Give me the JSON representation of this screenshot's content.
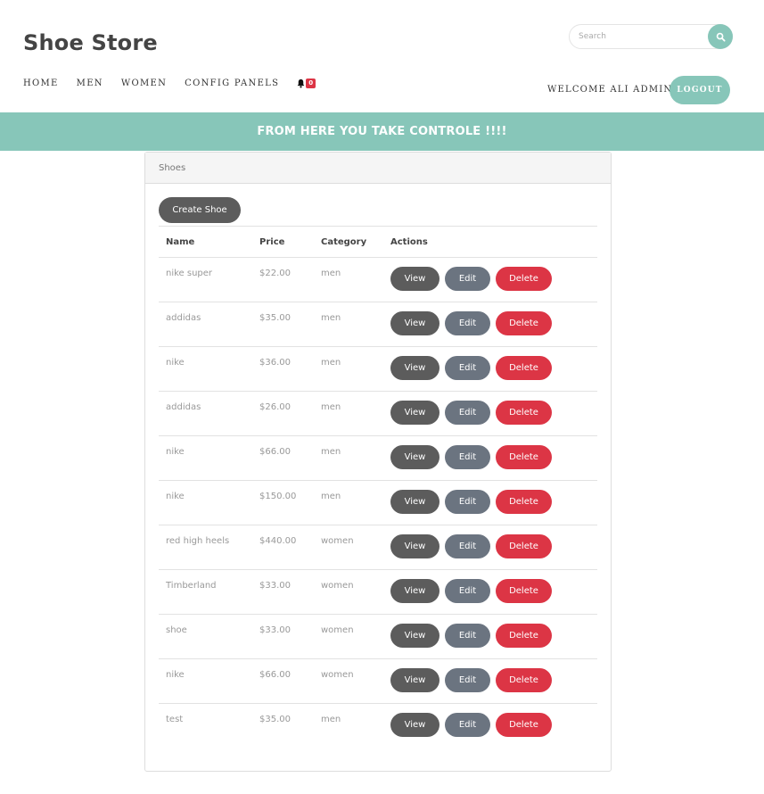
{
  "brand": "Shoe Store",
  "search": {
    "placeholder": "Search"
  },
  "nav": {
    "items": [
      "HOME",
      "MEN",
      "WOMEN",
      "CONFIG PANELS"
    ],
    "notification_count": "0"
  },
  "user": {
    "welcome": "WELCOME ALI ADMIN",
    "logout_label": "LOGOUT"
  },
  "banner": "FROM HERE YOU TAKE CONTROLE !!!!",
  "card": {
    "title": "Shoes",
    "create_label": "Create Shoe",
    "headers": {
      "name": "Name",
      "price": "Price",
      "category": "Category",
      "actions": "Actions"
    },
    "actions": {
      "view": "View",
      "edit": "Edit",
      "delete": "Delete"
    },
    "rows": [
      {
        "name": "nike super",
        "price": "$22.00",
        "category": "men"
      },
      {
        "name": "addidas",
        "price": "$35.00",
        "category": "men"
      },
      {
        "name": "nike",
        "price": "$36.00",
        "category": "men"
      },
      {
        "name": "addidas",
        "price": "$26.00",
        "category": "men"
      },
      {
        "name": "nike",
        "price": "$66.00",
        "category": "men"
      },
      {
        "name": "nike",
        "price": "$150.00",
        "category": "men"
      },
      {
        "name": "red high heels",
        "price": "$440.00",
        "category": "women"
      },
      {
        "name": "Timberland",
        "price": "$33.00",
        "category": "women"
      },
      {
        "name": "shoe",
        "price": "$33.00",
        "category": "women"
      },
      {
        "name": "nike",
        "price": "$66.00",
        "category": "women"
      },
      {
        "name": "test",
        "price": "$35.00",
        "category": "men"
      }
    ]
  },
  "colors": {
    "accent": "#87c6b9",
    "dark_button": "#5c5c5c",
    "edit_button": "#6b7480",
    "delete_button": "#dc3545"
  }
}
